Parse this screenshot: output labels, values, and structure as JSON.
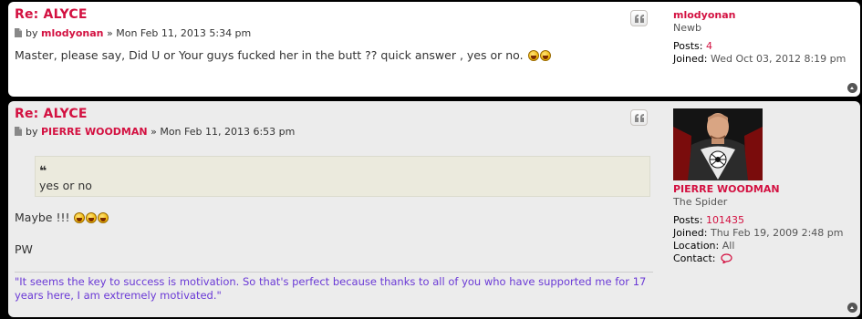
{
  "posts": [
    {
      "title": "Re: ALYCE",
      "by": "by",
      "author": "mlodyonan",
      "sep": "»",
      "date": "Mon Feb 11, 2013 5:34 pm",
      "content": "Master, please say, Did U or Your guys fucked her in the butt ?? quick answer , yes or no.",
      "profile": {
        "username": "mlodyonan",
        "rank": "Newb",
        "posts_label": "Posts:",
        "posts_value": "4",
        "joined_label": "Joined:",
        "joined_value": "Wed Oct 03, 2012 8:19 pm"
      }
    },
    {
      "title": "Re: ALYCE",
      "by": "by",
      "author": "PIERRE WOODMAN",
      "sep": "»",
      "date": "Mon Feb 11, 2013 6:53 pm",
      "quote_text": "yes or no",
      "content_line1": "Maybe !!!",
      "content_line2": "PW",
      "signature": "\"It seems the key to success is motivation. So that's perfect because thanks to all of you who have supported me for 17 years here, I am extremely motivated.\"",
      "profile": {
        "username": "PIERRE WOODMAN",
        "rank": "The Spider",
        "posts_label": "Posts:",
        "posts_value": "101435",
        "joined_label": "Joined:",
        "joined_value": "Thu Feb 19, 2009 2:48 pm",
        "location_label": "Location:",
        "location_value": "All",
        "contact_label": "Contact:"
      }
    }
  ],
  "colors": {
    "accent": "#d31141",
    "signature": "#6b3ad6",
    "quote_bg": "#ebeadd"
  },
  "icons": [
    "document-icon",
    "quote-icon",
    "smiley-icon",
    "back-to-top-icon",
    "contact-icon",
    "avatar-image"
  ]
}
